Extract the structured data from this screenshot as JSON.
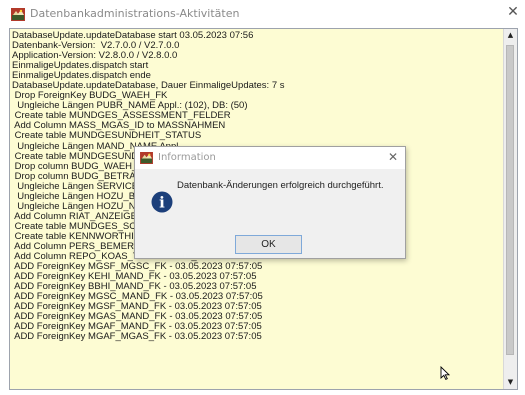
{
  "window": {
    "title": "Datenbankadministrations-Aktivitäten",
    "close_glyph": "✕"
  },
  "log": {
    "lines": [
      "DatabaseUpdate.updateDatabase start 03.05.2023 07:56",
      "Datenbank-Version:  V2.7.0.0 / V2.7.0.0",
      "Application-Version: V2.8.0.0 / V2.8.0.0",
      "EinmaligeUpdates.dispatch start",
      "EinmaligeUpdates.dispatch ende",
      "DatabaseUpdate.updateDatabase, Dauer EinmaligeUpdates: 7 s",
      " Drop ForeignKey BUDG_WAEH_FK",
      "  Ungleiche Längen PUBR_NAME Appl.: (102), DB: (50)",
      " Create table MUNDGES_ASSESSMENT_FELDER",
      " Add Column MASS_MGAS_ID to MASSNAHMEN",
      " Create table MUNDGESUNDHEIT_STATUS",
      "  Ungleiche Längen MAND_NAME Appl.",
      " Create table MUNDGESUNDHEIT_SCREENING",
      " Drop column BUDG_WAEH_ID",
      " Drop column BUDG_BETRAG_UMG",
      "  Ungleiche Längen SERVICE_NAME",
      "  Ungleiche Längen HOZU_BEMERKUNG",
      "  Ungleiche Längen HOZU_NAME Appl.",
      " Add Column RIAT_ANZEIGE",
      " Create table MUNDGES_SCREENING_FELDER",
      " Create table KENNWORTHISTORIEN",
      " Add Column PERS_BEMERKUNG_GEWICHT to PERSONEN",
      " Add Column REPO_KOAS_TYP to RECH_POSITIONEN",
      " ADD ForeignKey MGSF_MGSC_FK - 03.05.2023 07:57:05",
      " ADD ForeignKey KEHI_MAND_FK - 03.05.2023 07:57:05",
      " ADD ForeignKey BBHI_MAND_FK - 03.05.2023 07:57:05",
      " ADD ForeignKey MGSC_MAND_FK - 03.05.2023 07:57:05",
      " ADD ForeignKey MGSF_MAND_FK - 03.05.2023 07:57:05",
      " ADD ForeignKey MGAS_MAND_FK - 03.05.2023 07:57:05",
      " ADD ForeignKey MGAF_MAND_FK - 03.05.2023 07:57:05",
      " ADD ForeignKey MGAF_MGAS_FK - 03.05.2023 07:57:05"
    ]
  },
  "scrollbar": {
    "up_glyph": "▲",
    "down_glyph": "▼"
  },
  "dialog": {
    "title": "Information",
    "close_glyph": "✕",
    "message": "Datenbank-Änderungen erfolgreich durchgeführt.",
    "ok_label": "OK",
    "info_glyph": "i"
  },
  "colors": {
    "log_background": "#fdfcd3",
    "info_icon": "#1c3f7a",
    "dialog_background": "#f0f0f0",
    "ok_border": "#7fa9d9"
  }
}
